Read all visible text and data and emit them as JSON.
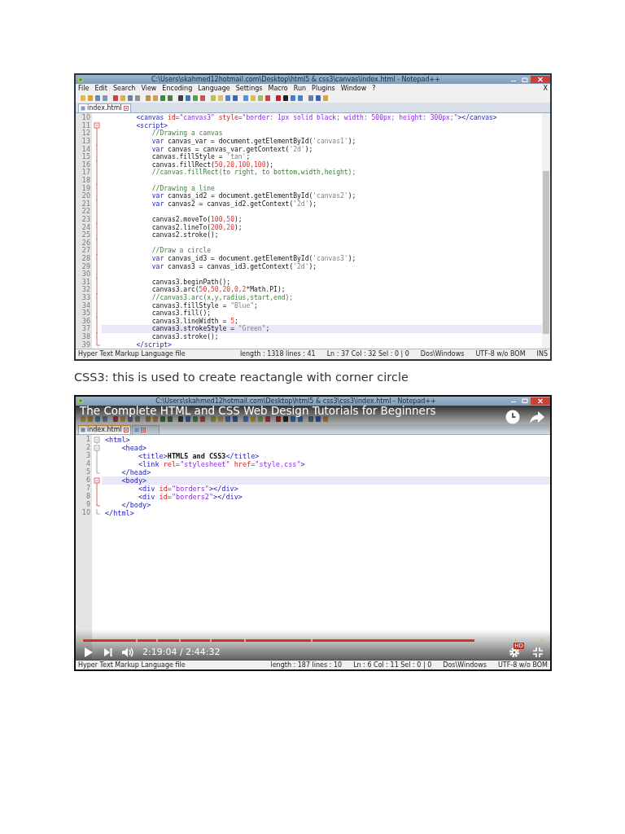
{
  "blocks": [
    {
      "kind": "screenshot",
      "window_title": "C:\\Users\\skahmed12hotmail.com\\Desktop\\html5 & css3\\canvas\\index.html - Notepad++",
      "menu": [
        "File",
        "Edit",
        "Search",
        "View",
        "Encoding",
        "Language",
        "Settings",
        "Macro",
        "Run",
        "Plugins",
        "Window",
        "?"
      ],
      "close_document": "X",
      "tabs": [
        {
          "label": "index.html",
          "selected": true
        }
      ],
      "lines": [
        {
          "number": "10",
          "segments": [
            {
              "text": "        <canvas",
              "kind": "tag"
            },
            {
              "text": " id=",
              "kind": "attr"
            },
            {
              "text": "\"canvas3\"",
              "kind": "value"
            },
            {
              "text": " style=",
              "kind": "attr"
            },
            {
              "text": "\"border: 1px solid black; width: 500px; height: 300px;\"",
              "kind": "value"
            },
            {
              "text": "></canvas>",
              "kind": "tag"
            }
          ],
          "highlighted": false
        },
        {
          "number": "11",
          "fold": {
            "kind": "start",
            "active": true
          },
          "segments": [
            {
              "text": "        <script>",
              "kind": "tag"
            }
          ],
          "highlighted": false
        },
        {
          "number": "12",
          "fold": {
            "kind": "mid",
            "active": true
          },
          "segments": [
            {
              "text": "            //Drawing a canvas",
              "kind": "comment"
            }
          ],
          "highlighted": false
        },
        {
          "number": "13",
          "fold": {
            "kind": "mid",
            "active": true
          },
          "segments": [
            {
              "text": "            var",
              "kind": "keyword"
            },
            {
              "text": " canvas_var = document.getElementById(",
              "kind": "plain"
            },
            {
              "text": "'canvas1'",
              "kind": "string"
            },
            {
              "text": ");",
              "kind": "plain"
            }
          ],
          "highlighted": false
        },
        {
          "number": "14",
          "fold": {
            "kind": "mid",
            "active": true
          },
          "segments": [
            {
              "text": "            var",
              "kind": "keyword"
            },
            {
              "text": " canvas = canvas_var.getContext(",
              "kind": "plain"
            },
            {
              "text": "'2d'",
              "kind": "string"
            },
            {
              "text": ");",
              "kind": "plain"
            }
          ],
          "highlighted": false
        },
        {
          "number": "15",
          "fold": {
            "kind": "mid",
            "active": true
          },
          "segments": [
            {
              "text": "            canvas.fillStyle = ",
              "kind": "plain"
            },
            {
              "text": "'tan'",
              "kind": "string"
            },
            {
              "text": ";",
              "kind": "plain"
            }
          ],
          "highlighted": false
        },
        {
          "number": "16",
          "fold": {
            "kind": "mid",
            "active": true
          },
          "segments": [
            {
              "text": "            canvas.fillRect(",
              "kind": "plain"
            },
            {
              "text": "50,20,100,100",
              "kind": "number"
            },
            {
              "text": ");",
              "kind": "plain"
            }
          ],
          "highlighted": false
        },
        {
          "number": "17",
          "fold": {
            "kind": "mid",
            "active": true
          },
          "segments": [
            {
              "text": "            //canvas.fillRect(to right, to bottom,width,height);",
              "kind": "comment"
            }
          ],
          "highlighted": false
        },
        {
          "number": "18",
          "fold": {
            "kind": "mid",
            "active": true
          },
          "highlighted": false
        },
        {
          "number": "19",
          "fold": {
            "kind": "mid",
            "active": true
          },
          "segments": [
            {
              "text": "            //Drawing a line",
              "kind": "comment"
            }
          ],
          "highlighted": false
        },
        {
          "number": "20",
          "fold": {
            "kind": "mid",
            "active": true
          },
          "segments": [
            {
              "text": "            var",
              "kind": "keyword"
            },
            {
              "text": " canvas_id2 = document.getElementById(",
              "kind": "plain"
            },
            {
              "text": "'canvas2'",
              "kind": "string"
            },
            {
              "text": ");",
              "kind": "plain"
            }
          ],
          "highlighted": false
        },
        {
          "number": "21",
          "fold": {
            "kind": "mid",
            "active": true
          },
          "segments": [
            {
              "text": "            var",
              "kind": "keyword"
            },
            {
              "text": " canvas2 = canvas_id2.getContext(",
              "kind": "plain"
            },
            {
              "text": "'2d'",
              "kind": "string"
            },
            {
              "text": ");",
              "kind": "plain"
            }
          ],
          "highlighted": false
        },
        {
          "number": "22",
          "fold": {
            "kind": "mid",
            "active": true
          },
          "highlighted": false
        },
        {
          "number": "23",
          "fold": {
            "kind": "mid",
            "active": true
          },
          "segments": [
            {
              "text": "            canvas2.moveTo(",
              "kind": "plain"
            },
            {
              "text": "100,50",
              "kind": "number"
            },
            {
              "text": ");",
              "kind": "plain"
            }
          ],
          "highlighted": false
        },
        {
          "number": "24",
          "fold": {
            "kind": "mid",
            "active": true
          },
          "segments": [
            {
              "text": "            canvas2.lineTo(",
              "kind": "plain"
            },
            {
              "text": "200,20",
              "kind": "number"
            },
            {
              "text": ");",
              "kind": "plain"
            }
          ],
          "highlighted": false
        },
        {
          "number": "25",
          "fold": {
            "kind": "mid",
            "active": true
          },
          "segments": [
            {
              "text": "            canvas2.stroke();",
              "kind": "plain"
            }
          ],
          "highlighted": false
        },
        {
          "number": "26",
          "fold": {
            "kind": "mid",
            "active": true
          },
          "highlighted": false
        },
        {
          "number": "27",
          "fold": {
            "kind": "mid",
            "active": true
          },
          "segments": [
            {
              "text": "            //Draw a circle",
              "kind": "comment"
            }
          ],
          "highlighted": false
        },
        {
          "number": "28",
          "fold": {
            "kind": "mid",
            "active": true
          },
          "segments": [
            {
              "text": "            var",
              "kind": "keyword"
            },
            {
              "text": " canvas_id3 = document.getElementById(",
              "kind": "plain"
            },
            {
              "text": "'canvas3'",
              "kind": "string"
            },
            {
              "text": ");",
              "kind": "plain"
            }
          ],
          "highlighted": false
        },
        {
          "number": "29",
          "fold": {
            "kind": "mid",
            "active": true
          },
          "segments": [
            {
              "text": "            var",
              "kind": "keyword"
            },
            {
              "text": " canvas3 = canvas_id3.getContext(",
              "kind": "plain"
            },
            {
              "text": "'2d'",
              "kind": "string"
            },
            {
              "text": ");",
              "kind": "plain"
            }
          ],
          "highlighted": false
        },
        {
          "number": "30",
          "fold": {
            "kind": "mid",
            "active": true
          },
          "highlighted": false
        },
        {
          "number": "31",
          "fold": {
            "kind": "mid",
            "active": true
          },
          "segments": [
            {
              "text": "            canvas3.beginPath();",
              "kind": "plain"
            }
          ],
          "highlighted": false
        },
        {
          "number": "32",
          "fold": {
            "kind": "mid",
            "active": true
          },
          "segments": [
            {
              "text": "            canvas3.arc(",
              "kind": "plain"
            },
            {
              "text": "50,50,20,0,2",
              "kind": "number"
            },
            {
              "text": "*Math.PI);",
              "kind": "plain"
            }
          ],
          "highlighted": false
        },
        {
          "number": "33",
          "fold": {
            "kind": "mid",
            "active": true
          },
          "segments": [
            {
              "text": "            //canvas3.arc(x,y,radius,start,end);",
              "kind": "comment"
            }
          ],
          "highlighted": false
        },
        {
          "number": "34",
          "fold": {
            "kind": "mid",
            "active": true
          },
          "segments": [
            {
              "text": "            canvas3.fillStyle = ",
              "kind": "plain"
            },
            {
              "text": "\"Blue\"",
              "kind": "string"
            },
            {
              "text": ";",
              "kind": "plain"
            }
          ],
          "highlighted": false
        },
        {
          "number": "35",
          "fold": {
            "kind": "mid",
            "active": true
          },
          "segments": [
            {
              "text": "            canvas3.fill();",
              "kind": "plain"
            }
          ],
          "highlighted": false
        },
        {
          "number": "36",
          "fold": {
            "kind": "mid",
            "active": true
          },
          "segments": [
            {
              "text": "            canvas3.lineWidth = ",
              "kind": "plain"
            },
            {
              "text": "5",
              "kind": "number"
            },
            {
              "text": ";",
              "kind": "plain"
            }
          ],
          "highlighted": false
        },
        {
          "number": "37",
          "fold": {
            "kind": "mid",
            "active": true
          },
          "segments": [
            {
              "text": "            canvas3.strokeStyle = ",
              "kind": "plain"
            },
            {
              "text": "\"Green\"",
              "kind": "string"
            },
            {
              "text": ";",
              "kind": "plain"
            }
          ],
          "highlighted": true
        },
        {
          "number": "38",
          "fold": {
            "kind": "mid",
            "active": true
          },
          "segments": [
            {
              "text": "            canvas3.stroke();",
              "kind": "plain"
            }
          ],
          "highlighted": false
        },
        {
          "number": "39",
          "fold": {
            "kind": "end",
            "active": true
          },
          "segments": [
            {
              "text": "        </script>",
              "kind": "tag"
            }
          ],
          "highlighted": false
        }
      ],
      "status_bar": [
        "Hyper Text Markup Language file",
        "length : 1318    lines : 41",
        "Ln : 37    Col : 32    Sel : 0 | 0",
        "Dos\\Windows",
        "UTF-8 w/o BOM",
        "INS"
      ]
    },
    {
      "kind": "paragraph",
      "text": "CSS3: this is used to create reactangle with corner circle"
    },
    {
      "kind": "screenshot",
      "window_title": "C:\\Users\\skahmed12hotmail.com\\Desktop\\html5 & css3\\css3\\index.html - Notepad++",
      "tabs": [
        {
          "label": "index.html",
          "selected": true
        },
        {
          "selected": false
        }
      ],
      "lines": [
        {
          "number": "1",
          "fold": {
            "kind": "start",
            "active": false
          },
          "segments": [
            {
              "text": "<html>",
              "kind": "tag"
            }
          ],
          "highlighted": false
        },
        {
          "number": "2",
          "fold": {
            "kind": "start",
            "active": false
          },
          "segments": [
            {
              "text": "    <head>",
              "kind": "tag"
            }
          ],
          "highlighted": false
        },
        {
          "number": "3",
          "fold": {
            "kind": "mid",
            "active": false
          },
          "segments": [
            {
              "text": "        <title>",
              "kind": "tag"
            },
            {
              "text": "HTML5 and CSS3",
              "kind": "bold"
            },
            {
              "text": "</title>",
              "kind": "tag"
            }
          ],
          "highlighted": false
        },
        {
          "number": "4",
          "fold": {
            "kind": "mid",
            "active": false
          },
          "segments": [
            {
              "text": "        <link",
              "kind": "tag"
            },
            {
              "text": " rel=",
              "kind": "attr"
            },
            {
              "text": "\"stylesheet\"",
              "kind": "value"
            },
            {
              "text": " href=",
              "kind": "attr"
            },
            {
              "text": "\"style.css\"",
              "kind": "value"
            },
            {
              "text": ">",
              "kind": "tag"
            }
          ],
          "highlighted": false
        },
        {
          "number": "5",
          "fold": {
            "kind": "end",
            "active": false
          },
          "segments": [
            {
              "text": "    </head>",
              "kind": "tag"
            }
          ],
          "highlighted": false
        },
        {
          "number": "6",
          "fold": {
            "kind": "start",
            "active": true
          },
          "segments": [
            {
              "text": "    <body>",
              "kind": "tag"
            }
          ],
          "highlighted": true
        },
        {
          "number": "7",
          "fold": {
            "kind": "mid",
            "active": true
          },
          "segments": [
            {
              "text": "        <div",
              "kind": "tag"
            },
            {
              "text": " id=",
              "kind": "attr"
            },
            {
              "text": "\"borders\"",
              "kind": "value"
            },
            {
              "text": "></div>",
              "kind": "tag"
            }
          ],
          "highlighted": false
        },
        {
          "number": "8",
          "fold": {
            "kind": "mid",
            "active": true
          },
          "segments": [
            {
              "text": "        <div",
              "kind": "tag"
            },
            {
              "text": " id=",
              "kind": "attr"
            },
            {
              "text": "\"borders2\"",
              "kind": "value"
            },
            {
              "text": "></div>",
              "kind": "tag"
            }
          ],
          "highlighted": false
        },
        {
          "number": "9",
          "fold": {
            "kind": "end",
            "active": true
          },
          "segments": [
            {
              "text": "    </body>",
              "kind": "tag"
            }
          ],
          "highlighted": false
        },
        {
          "number": "10",
          "fold": {
            "kind": "end",
            "active": false
          },
          "segments": [
            {
              "text": "</html>",
              "kind": "tag"
            }
          ],
          "highlighted": false
        }
      ],
      "status_bar": [
        "Hyper Text Markup Language file",
        "length : 187    lines : 10",
        "Ln : 6    Col : 11    Sel : 0 | 0",
        "Dos\\Windows",
        "UTF-8 w/o BOM"
      ],
      "video": {
        "title": "The Complete HTML and CSS Web Design Tutorials for Beginners",
        "progress": {
          "level": 0.85
        },
        "time": "2:19:04 / 2:44:32",
        "quality_badge": "HD"
      }
    }
  ]
}
